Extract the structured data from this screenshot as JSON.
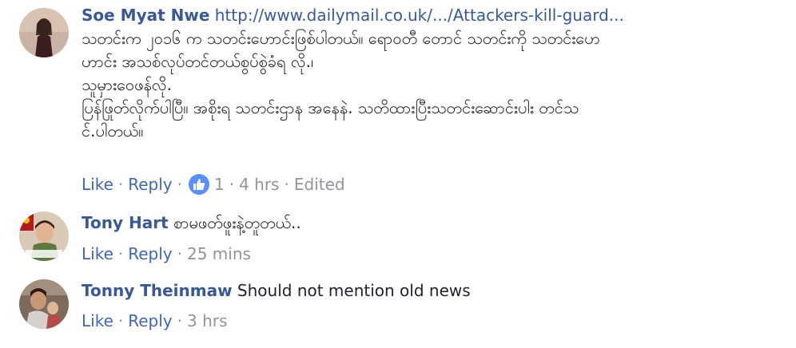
{
  "comments": [
    {
      "author": "Soe Myat Nwe",
      "link": "http://www.dailymail.co.uk/.../Attackers-kill-guard...",
      "lines": [
        "သတင်းက ၂၀၁၆ က သတင်းဟောင်းဖြစ်ပါတယ်။ ရောဝတီ တောင် သတင်းကို သတင်းဟေ",
        "ဟာင်း အသစ်လုပ်တင်တယ်စွပ်စွဲခံရ လို.၊",
        "သူမှားဝေဖန်လို.",
        "ပြန်ဖြုတ်လိုက်ပါပြီ။ အစိုးရ သတင်းဌာန အနေနဲ. သတိထားပြီးသတင်းဆောင်းပါး တင်သ",
        "င်.ပါတယ်။"
      ],
      "actions": {
        "like": "Like",
        "reply": "Reply",
        "reactions": "1",
        "time": "4 hrs",
        "edited": "Edited"
      }
    },
    {
      "author": "Tony Hart",
      "text": "စာမဖတ်ဖူးနဲ့တူတယ်..",
      "actions": {
        "like": "Like",
        "reply": "Reply",
        "time": "25 mins"
      }
    },
    {
      "author": "Tonny Theinmaw",
      "text": "Should not mention old news",
      "actions": {
        "like": "Like",
        "reply": "Reply",
        "time": "3 hrs"
      }
    }
  ],
  "colors": {
    "name": "#385898",
    "action": "#4267b2",
    "meta": "#90949c",
    "like_badge": "#5890ff"
  }
}
